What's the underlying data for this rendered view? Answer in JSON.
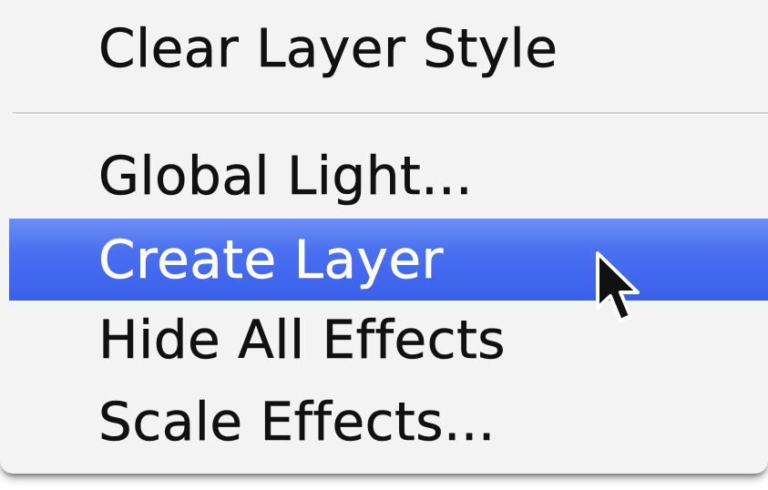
{
  "menu": {
    "items": [
      {
        "label": "Clear Layer Style"
      },
      {
        "label": "Global Light..."
      },
      {
        "label": "Create Layer",
        "highlighted": true
      },
      {
        "label": "Hide All Effects"
      },
      {
        "label": "Scale Effects..."
      }
    ]
  },
  "colors": {
    "highlight": "#3f65ee",
    "menu_background": "#f3f3f3",
    "text": "#111111"
  },
  "cursor": {
    "icon": "arrow-cursor-icon"
  }
}
